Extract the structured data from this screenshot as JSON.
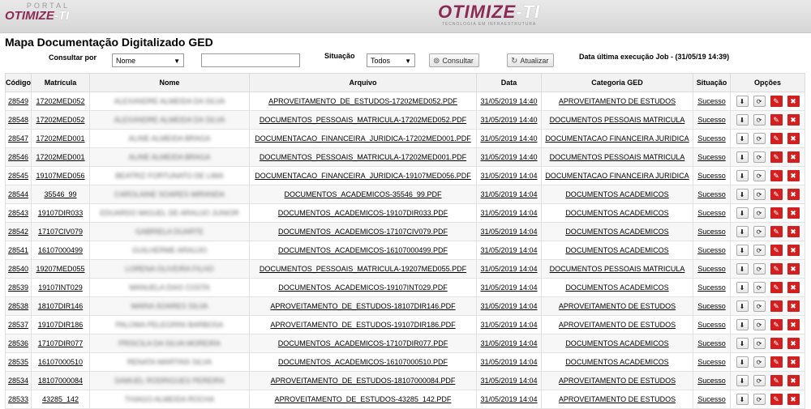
{
  "header": {
    "portal_label": "PORTAL",
    "brand": "OTIMIZE",
    "brand_suffix": "-TI",
    "brand_tagline": "TECNOLOGIA EM INFRAESTRUTURA"
  },
  "page": {
    "title": "Mapa Documentação Digitalizado GED"
  },
  "filters": {
    "consultar_label": "Consultar por",
    "consultar_value": "Nome",
    "search_value": "",
    "situacao_label": "Situação",
    "situacao_value": "Todos",
    "consultar_button": "Consultar",
    "atualizar_button": "Atualizar",
    "last_run": "Data última execução Job - (31/05/19 14:39)"
  },
  "table": {
    "columns": [
      "Código",
      "Matrícula",
      "Nome",
      "Arquivo",
      "Data",
      "Categoria GED",
      "Situação",
      "Opções"
    ],
    "rows": [
      {
        "codigo": "28549",
        "matricula": "17202MED052",
        "nome": "ALEXANDRE ALMEIDA DA SILVA",
        "arquivo": "APROVEITAMENTO_DE_ESTUDOS-17202MED052.PDF",
        "data": "31/05/2019 14:40",
        "categoria": "APROVEITAMENTO DE ESTUDOS",
        "situacao": "Sucesso"
      },
      {
        "codigo": "28548",
        "matricula": "17202MED052",
        "nome": "ALEXANDRE ALMEIDA DA SILVA",
        "arquivo": "DOCUMENTOS_PESSOAIS_MATRICULA-17202MED052.PDF",
        "data": "31/05/2019 14:40",
        "categoria": "DOCUMENTOS PESSOAIS MATRICULA",
        "situacao": "Sucesso"
      },
      {
        "codigo": "28547",
        "matricula": "17202MED001",
        "nome": "ALINE ALMEIDA BRAGA",
        "arquivo": "DOCUMENTACAO_FINANCEIRA_JURIDICA-17202MED001.PDF",
        "data": "31/05/2019 14:40",
        "categoria": "DOCUMENTACAO FINANCEIRA JURIDICA",
        "situacao": "Sucesso"
      },
      {
        "codigo": "28546",
        "matricula": "17202MED001",
        "nome": "ALINE ALMEIDA BRAGA",
        "arquivo": "DOCUMENTOS_PESSOAIS_MATRICULA-17202MED001.PDF",
        "data": "31/05/2019 14:40",
        "categoria": "DOCUMENTOS PESSOAIS MATRICULA",
        "situacao": "Sucesso"
      },
      {
        "codigo": "28545",
        "matricula": "19107MED056",
        "nome": "BEATRIZ FORTUNATO DE LIMA",
        "arquivo": "DOCUMENTACAO_FINANCEIRA_JURIDICA-19107MED056.PDF",
        "data": "31/05/2019 14:04",
        "categoria": "DOCUMENTACAO FINANCEIRA JURIDICA",
        "situacao": "Sucesso"
      },
      {
        "codigo": "28544",
        "matricula": "35546_99",
        "nome": "CAROLAINE SOARES MIRANDA",
        "arquivo": "DOCUMENTOS_ACADEMICOS-35546_99.PDF",
        "data": "31/05/2019 14:04",
        "categoria": "DOCUMENTOS ACADEMICOS",
        "situacao": "Sucesso"
      },
      {
        "codigo": "28543",
        "matricula": "19107DIR033",
        "nome": "EDUARDO MIGUEL DE ARAUJO JUNIOR",
        "arquivo": "DOCUMENTOS_ACADEMICOS-19107DIR033.PDF",
        "data": "31/05/2019 14:04",
        "categoria": "DOCUMENTOS ACADEMICOS",
        "situacao": "Sucesso"
      },
      {
        "codigo": "28542",
        "matricula": "17107CIV079",
        "nome": "GABRIELA DUARTE",
        "arquivo": "DOCUMENTOS_ACADEMICOS-17107CIV079.PDF",
        "data": "31/05/2019 14:04",
        "categoria": "DOCUMENTOS ACADEMICOS",
        "situacao": "Sucesso"
      },
      {
        "codigo": "28541",
        "matricula": "16107000499",
        "nome": "GUILHERME ARAUJO",
        "arquivo": "DOCUMENTOS_ACADEMICOS-16107000499.PDF",
        "data": "31/05/2019 14:04",
        "categoria": "DOCUMENTOS ACADEMICOS",
        "situacao": "Sucesso"
      },
      {
        "codigo": "28540",
        "matricula": "19207MED055",
        "nome": "LORENA OLIVEIRA FILHO",
        "arquivo": "DOCUMENTOS_PESSOAIS_MATRICULA-19207MED055.PDF",
        "data": "31/05/2019 14:04",
        "categoria": "DOCUMENTOS PESSOAIS MATRICULA",
        "situacao": "Sucesso"
      },
      {
        "codigo": "28539",
        "matricula": "19107INT029",
        "nome": "MANUELA DIAS COSTA",
        "arquivo": "DOCUMENTOS_ACADEMICOS-19107INT029.PDF",
        "data": "31/05/2019 14:04",
        "categoria": "DOCUMENTOS ACADEMICOS",
        "situacao": "Sucesso"
      },
      {
        "codigo": "28538",
        "matricula": "18107DIR146",
        "nome": "MARIA SOARES SILVA",
        "arquivo": "APROVEITAMENTO_DE_ESTUDOS-18107DIR146.PDF",
        "data": "31/05/2019 14:04",
        "categoria": "APROVEITAMENTO DE ESTUDOS",
        "situacao": "Sucesso"
      },
      {
        "codigo": "28537",
        "matricula": "19107DIR186",
        "nome": "PALOMA PELEGRINI BARBOSA",
        "arquivo": "APROVEITAMENTO_DE_ESTUDOS-19107DIR186.PDF",
        "data": "31/05/2019 14:04",
        "categoria": "APROVEITAMENTO DE ESTUDOS",
        "situacao": "Sucesso"
      },
      {
        "codigo": "28536",
        "matricula": "17107DIR077",
        "nome": "PRISCILA DA SILVA MOREIRA",
        "arquivo": "DOCUMENTOS_ACADEMICOS-17107DIR077.PDF",
        "data": "31/05/2019 14:04",
        "categoria": "DOCUMENTOS ACADEMICOS",
        "situacao": "Sucesso"
      },
      {
        "codigo": "28535",
        "matricula": "16107000510",
        "nome": "RENATA MARTINS SILVA",
        "arquivo": "DOCUMENTOS_ACADEMICOS-16107000510.PDF",
        "data": "31/05/2019 14:04",
        "categoria": "DOCUMENTOS ACADEMICOS",
        "situacao": "Sucesso"
      },
      {
        "codigo": "28534",
        "matricula": "18107000084",
        "nome": "SAMUEL RODRIGUES PEREIRA",
        "arquivo": "APROVEITAMENTO_DE_ESTUDOS-18107000084.PDF",
        "data": "31/05/2019 14:04",
        "categoria": "APROVEITAMENTO DE ESTUDOS",
        "situacao": "Sucesso"
      },
      {
        "codigo": "28533",
        "matricula": "43285_142",
        "nome": "THIAGO ALMEIDA ROCHA",
        "arquivo": "APROVEITAMENTO_DE_ESTUDOS-43285_142.PDF",
        "data": "31/05/2019 14:04",
        "categoria": "APROVEITAMENTO DE ESTUDOS",
        "situacao": "Sucesso"
      }
    ]
  }
}
